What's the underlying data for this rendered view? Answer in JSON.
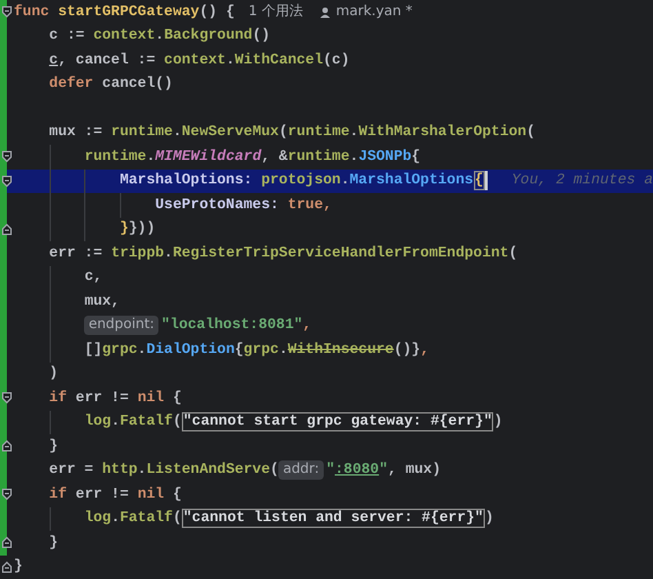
{
  "lines": [
    {
      "fold_open": true,
      "fold_close": false,
      "changed": true,
      "selected": false,
      "tokens": [
        {
          "text": "func ",
          "kind": "kw"
        },
        {
          "text": "startGRPCGateway",
          "kind": "decl"
        },
        {
          "text": "() {",
          "kind": "plain"
        }
      ],
      "usages": "1 个用法",
      "author": "mark.yan *"
    },
    {
      "fold_open": false,
      "fold_close": false,
      "changed": true,
      "selected": false,
      "tokens": [
        {
          "text": "    c := ",
          "kind": "plain"
        },
        {
          "text": "context",
          "kind": "call"
        },
        {
          "text": ".",
          "kind": "plain"
        },
        {
          "text": "Background",
          "kind": "call"
        },
        {
          "text": "()",
          "kind": "plain"
        }
      ]
    },
    {
      "fold_open": false,
      "fold_close": false,
      "changed": true,
      "selected": false,
      "tokens": [
        {
          "text": "    c",
          "kind": "var-underlined"
        },
        {
          "text": ", cancel := ",
          "kind": "plain"
        },
        {
          "text": "context",
          "kind": "call"
        },
        {
          "text": ".",
          "kind": "plain"
        },
        {
          "text": "WithCancel",
          "kind": "call"
        },
        {
          "text": "(c)",
          "kind": "plain"
        }
      ]
    },
    {
      "fold_open": false,
      "fold_close": false,
      "changed": true,
      "selected": false,
      "tokens": [
        {
          "text": "    defer",
          "kind": "kw"
        },
        {
          "text": " cancel()",
          "kind": "plain"
        }
      ]
    },
    {
      "fold_open": false,
      "fold_close": false,
      "changed": true,
      "selected": false
    },
    {
      "fold_open": false,
      "fold_close": false,
      "changed": true,
      "selected": false,
      "tokens": [
        {
          "text": "    mux := ",
          "kind": "plain"
        },
        {
          "text": "runtime",
          "kind": "call"
        },
        {
          "text": ".",
          "kind": "plain"
        },
        {
          "text": "NewServeMux",
          "kind": "call"
        },
        {
          "text": "(",
          "kind": "plain"
        },
        {
          "text": "runtime",
          "kind": "call"
        },
        {
          "text": ".",
          "kind": "plain"
        },
        {
          "text": "WithMarshalerOption",
          "kind": "call"
        },
        {
          "text": "(",
          "kind": "plain"
        }
      ]
    },
    {
      "fold_open": true,
      "fold_close": false,
      "changed": true,
      "selected": false,
      "tokens": [
        {
          "text": "        runtime",
          "kind": "call"
        },
        {
          "text": ".",
          "kind": "plain"
        },
        {
          "text": "MIMEWildcard",
          "kind": "const"
        },
        {
          "text": ", &",
          "kind": "plain"
        },
        {
          "text": "runtime",
          "kind": "call"
        },
        {
          "text": ".",
          "kind": "plain"
        },
        {
          "text": "JSONPb",
          "kind": "type"
        },
        {
          "text": "{",
          "kind": "plain"
        }
      ]
    },
    {
      "fold_open": true,
      "fold_close": false,
      "changed": true,
      "selected": true,
      "tokens": [
        {
          "text": "            MarshalOptions: ",
          "kind": "field"
        },
        {
          "text": "protojson",
          "kind": "call"
        },
        {
          "text": ".",
          "kind": "plain"
        },
        {
          "text": "MarshalOptions",
          "kind": "type"
        },
        {
          "text": "{",
          "kind": "brace-match"
        }
      ],
      "annotation": "You, 2 minutes a"
    },
    {
      "fold_open": false,
      "fold_close": false,
      "changed": true,
      "selected": false,
      "tokens": [
        {
          "text": "                UseProtoNames: ",
          "kind": "field"
        },
        {
          "text": "true,",
          "kind": "kw"
        }
      ]
    },
    {
      "fold_open": false,
      "fold_close": true,
      "changed": true,
      "selected": false,
      "tokens": [
        {
          "text": "            }",
          "kind": "brace"
        },
        {
          "text": "}))",
          "kind": "plain"
        }
      ]
    },
    {
      "fold_open": false,
      "fold_close": false,
      "changed": true,
      "selected": false,
      "tokens": [
        {
          "text": "    err := ",
          "kind": "plain"
        },
        {
          "text": "trippb",
          "kind": "call"
        },
        {
          "text": ".",
          "kind": "plain"
        },
        {
          "text": "RegisterTripServiceHandlerFromEndpoint",
          "kind": "call"
        },
        {
          "text": "(",
          "kind": "plain"
        }
      ]
    },
    {
      "fold_open": false,
      "fold_close": false,
      "changed": true,
      "selected": false,
      "tokens": [
        {
          "text": "        c,",
          "kind": "plain"
        }
      ]
    },
    {
      "fold_open": false,
      "fold_close": false,
      "changed": true,
      "selected": false,
      "tokens": [
        {
          "text": "        mux,",
          "kind": "plain"
        }
      ]
    },
    {
      "fold_open": false,
      "fold_close": false,
      "changed": true,
      "selected": false,
      "tokens": [
        {
          "text": "        endpoint:",
          "kind": "hint"
        },
        {
          "text": "\"localhost:8081\"",
          "kind": "str"
        },
        {
          "text": ",",
          "kind": "kw"
        }
      ]
    },
    {
      "fold_open": false,
      "fold_close": false,
      "changed": true,
      "selected": false,
      "tokens": [
        {
          "text": "        []",
          "kind": "plain"
        },
        {
          "text": "grpc",
          "kind": "call"
        },
        {
          "text": ".",
          "kind": "plain"
        },
        {
          "text": "DialOption",
          "kind": "type"
        },
        {
          "text": "{",
          "kind": "plain"
        },
        {
          "text": "grpc",
          "kind": "call"
        },
        {
          "text": ".",
          "kind": "plain"
        },
        {
          "text": "WithInsecure",
          "kind": "deprecated"
        },
        {
          "text": "()}",
          "kind": "plain"
        },
        {
          "text": ",",
          "kind": "kw"
        }
      ]
    },
    {
      "fold_open": false,
      "fold_close": false,
      "changed": true,
      "selected": false,
      "tokens": [
        {
          "text": "    )",
          "kind": "plain"
        }
      ]
    },
    {
      "fold_open": true,
      "fold_close": false,
      "changed": true,
      "selected": false,
      "tokens": [
        {
          "text": "    if",
          "kind": "kw"
        },
        {
          "text": " err != ",
          "kind": "plain"
        },
        {
          "text": "nil",
          "kind": "kw"
        },
        {
          "text": " {",
          "kind": "plain"
        }
      ]
    },
    {
      "fold_open": false,
      "fold_close": false,
      "changed": true,
      "selected": false,
      "tokens": [
        {
          "text": "        log",
          "kind": "call"
        },
        {
          "text": ".",
          "kind": "plain"
        },
        {
          "text": "Fatalf",
          "kind": "call"
        },
        {
          "text": "(",
          "kind": "plain"
        },
        {
          "text": "\"cannot start grpc gateway: #{err}\"",
          "kind": "boxed"
        },
        {
          "text": ")",
          "kind": "plain"
        }
      ]
    },
    {
      "fold_open": false,
      "fold_close": true,
      "changed": true,
      "selected": false,
      "tokens": [
        {
          "text": "    }",
          "kind": "plain"
        }
      ]
    },
    {
      "fold_open": false,
      "fold_close": false,
      "changed": true,
      "selected": false,
      "tokens": [
        {
          "text": "    err = ",
          "kind": "plain"
        },
        {
          "text": "http",
          "kind": "call"
        },
        {
          "text": ".",
          "kind": "plain"
        },
        {
          "text": "ListenAndServe",
          "kind": "call"
        },
        {
          "text": "(",
          "kind": "plain"
        },
        {
          "text": "addr:",
          "kind": "hint"
        },
        {
          "text": "\"",
          "kind": "str"
        },
        {
          "text": ":8080",
          "kind": "str-underlined"
        },
        {
          "text": "\"",
          "kind": "str"
        },
        {
          "text": ", mux)",
          "kind": "plain"
        }
      ]
    },
    {
      "fold_open": true,
      "fold_close": false,
      "changed": true,
      "selected": false,
      "tokens": [
        {
          "text": "    if",
          "kind": "kw"
        },
        {
          "text": " err != ",
          "kind": "plain"
        },
        {
          "text": "nil",
          "kind": "kw"
        },
        {
          "text": " {",
          "kind": "plain"
        }
      ]
    },
    {
      "fold_open": false,
      "fold_close": false,
      "changed": true,
      "selected": false,
      "tokens": [
        {
          "text": "        log",
          "kind": "call"
        },
        {
          "text": ".",
          "kind": "plain"
        },
        {
          "text": "Fatalf",
          "kind": "call"
        },
        {
          "text": "(",
          "kind": "plain"
        },
        {
          "text": "\"cannot listen and server: #{err}\"",
          "kind": "boxed"
        },
        {
          "text": ")",
          "kind": "plain"
        }
      ]
    },
    {
      "fold_open": false,
      "fold_close": true,
      "changed": true,
      "selected": false,
      "tokens": [
        {
          "text": "    }",
          "kind": "plain"
        }
      ]
    },
    {
      "fold_open": false,
      "fold_close": true,
      "changed": false,
      "selected": false,
      "tokens": [
        {
          "text": "}",
          "kind": "plain"
        }
      ]
    }
  ]
}
